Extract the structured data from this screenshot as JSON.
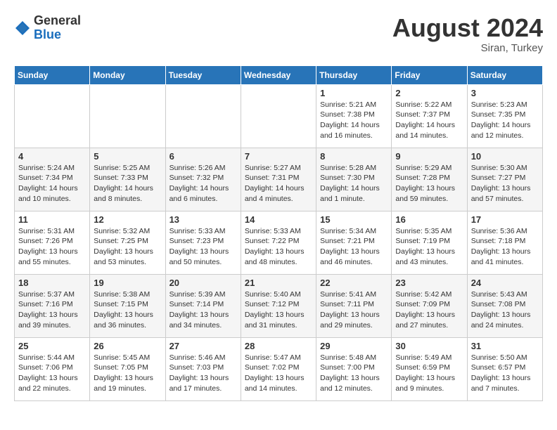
{
  "logo": {
    "general": "General",
    "blue": "Blue"
  },
  "title": {
    "month_year": "August 2024",
    "location": "Siran, Turkey"
  },
  "days_of_week": [
    "Sunday",
    "Monday",
    "Tuesday",
    "Wednesday",
    "Thursday",
    "Friday",
    "Saturday"
  ],
  "weeks": [
    [
      {
        "day": "",
        "info": ""
      },
      {
        "day": "",
        "info": ""
      },
      {
        "day": "",
        "info": ""
      },
      {
        "day": "",
        "info": ""
      },
      {
        "day": "1",
        "info": "Sunrise: 5:21 AM\nSunset: 7:38 PM\nDaylight: 14 hours\nand 16 minutes."
      },
      {
        "day": "2",
        "info": "Sunrise: 5:22 AM\nSunset: 7:37 PM\nDaylight: 14 hours\nand 14 minutes."
      },
      {
        "day": "3",
        "info": "Sunrise: 5:23 AM\nSunset: 7:35 PM\nDaylight: 14 hours\nand 12 minutes."
      }
    ],
    [
      {
        "day": "4",
        "info": "Sunrise: 5:24 AM\nSunset: 7:34 PM\nDaylight: 14 hours\nand 10 minutes."
      },
      {
        "day": "5",
        "info": "Sunrise: 5:25 AM\nSunset: 7:33 PM\nDaylight: 14 hours\nand 8 minutes."
      },
      {
        "day": "6",
        "info": "Sunrise: 5:26 AM\nSunset: 7:32 PM\nDaylight: 14 hours\nand 6 minutes."
      },
      {
        "day": "7",
        "info": "Sunrise: 5:27 AM\nSunset: 7:31 PM\nDaylight: 14 hours\nand 4 minutes."
      },
      {
        "day": "8",
        "info": "Sunrise: 5:28 AM\nSunset: 7:30 PM\nDaylight: 14 hours\nand 1 minute."
      },
      {
        "day": "9",
        "info": "Sunrise: 5:29 AM\nSunset: 7:28 PM\nDaylight: 13 hours\nand 59 minutes."
      },
      {
        "day": "10",
        "info": "Sunrise: 5:30 AM\nSunset: 7:27 PM\nDaylight: 13 hours\nand 57 minutes."
      }
    ],
    [
      {
        "day": "11",
        "info": "Sunrise: 5:31 AM\nSunset: 7:26 PM\nDaylight: 13 hours\nand 55 minutes."
      },
      {
        "day": "12",
        "info": "Sunrise: 5:32 AM\nSunset: 7:25 PM\nDaylight: 13 hours\nand 53 minutes."
      },
      {
        "day": "13",
        "info": "Sunrise: 5:33 AM\nSunset: 7:23 PM\nDaylight: 13 hours\nand 50 minutes."
      },
      {
        "day": "14",
        "info": "Sunrise: 5:33 AM\nSunset: 7:22 PM\nDaylight: 13 hours\nand 48 minutes."
      },
      {
        "day": "15",
        "info": "Sunrise: 5:34 AM\nSunset: 7:21 PM\nDaylight: 13 hours\nand 46 minutes."
      },
      {
        "day": "16",
        "info": "Sunrise: 5:35 AM\nSunset: 7:19 PM\nDaylight: 13 hours\nand 43 minutes."
      },
      {
        "day": "17",
        "info": "Sunrise: 5:36 AM\nSunset: 7:18 PM\nDaylight: 13 hours\nand 41 minutes."
      }
    ],
    [
      {
        "day": "18",
        "info": "Sunrise: 5:37 AM\nSunset: 7:16 PM\nDaylight: 13 hours\nand 39 minutes."
      },
      {
        "day": "19",
        "info": "Sunrise: 5:38 AM\nSunset: 7:15 PM\nDaylight: 13 hours\nand 36 minutes."
      },
      {
        "day": "20",
        "info": "Sunrise: 5:39 AM\nSunset: 7:14 PM\nDaylight: 13 hours\nand 34 minutes."
      },
      {
        "day": "21",
        "info": "Sunrise: 5:40 AM\nSunset: 7:12 PM\nDaylight: 13 hours\nand 31 minutes."
      },
      {
        "day": "22",
        "info": "Sunrise: 5:41 AM\nSunset: 7:11 PM\nDaylight: 13 hours\nand 29 minutes."
      },
      {
        "day": "23",
        "info": "Sunrise: 5:42 AM\nSunset: 7:09 PM\nDaylight: 13 hours\nand 27 minutes."
      },
      {
        "day": "24",
        "info": "Sunrise: 5:43 AM\nSunset: 7:08 PM\nDaylight: 13 hours\nand 24 minutes."
      }
    ],
    [
      {
        "day": "25",
        "info": "Sunrise: 5:44 AM\nSunset: 7:06 PM\nDaylight: 13 hours\nand 22 minutes."
      },
      {
        "day": "26",
        "info": "Sunrise: 5:45 AM\nSunset: 7:05 PM\nDaylight: 13 hours\nand 19 minutes."
      },
      {
        "day": "27",
        "info": "Sunrise: 5:46 AM\nSunset: 7:03 PM\nDaylight: 13 hours\nand 17 minutes."
      },
      {
        "day": "28",
        "info": "Sunrise: 5:47 AM\nSunset: 7:02 PM\nDaylight: 13 hours\nand 14 minutes."
      },
      {
        "day": "29",
        "info": "Sunrise: 5:48 AM\nSunset: 7:00 PM\nDaylight: 13 hours\nand 12 minutes."
      },
      {
        "day": "30",
        "info": "Sunrise: 5:49 AM\nSunset: 6:59 PM\nDaylight: 13 hours\nand 9 minutes."
      },
      {
        "day": "31",
        "info": "Sunrise: 5:50 AM\nSunset: 6:57 PM\nDaylight: 13 hours\nand 7 minutes."
      }
    ]
  ]
}
